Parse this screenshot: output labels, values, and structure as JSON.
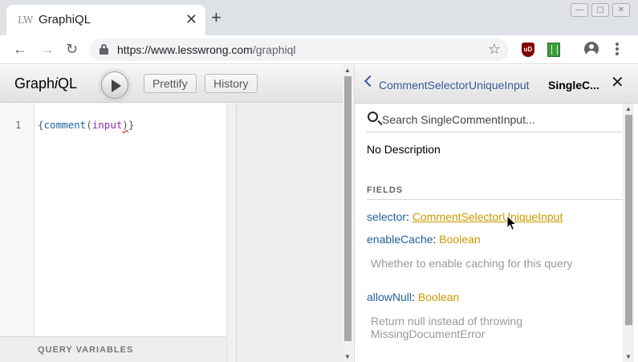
{
  "browser": {
    "tab_favicon": "LW",
    "tab_title": "GraphiQL",
    "tab_close": "✕",
    "new_tab": "+",
    "window_buttons": [
      "—",
      "▢",
      "✕"
    ],
    "back": "←",
    "forward": "→",
    "reload": "↻",
    "url_host": "https://www.lesswrong.com",
    "url_path": "/graphiql",
    "star": "☆",
    "ublock_label": "uD"
  },
  "graphiql": {
    "logo_prefix": "Graph",
    "logo_italic": "i",
    "logo_suffix": "QL",
    "prettify_label": "Prettify",
    "history_label": "History",
    "editor": {
      "line_number": "1",
      "code_open": "{",
      "code_fn": "comment",
      "code_paren_open": "(",
      "code_arg": "input",
      "code_paren_close": ")",
      "code_close": "}"
    },
    "query_variables_label": "QUERY VARIABLES"
  },
  "docs": {
    "back_label": "CommentSelectorUniqueInput",
    "title": "SingleC...",
    "close": "✕",
    "search_placeholder": "Search SingleCommentInput...",
    "description": "No Description",
    "fields_label": "FIELDS",
    "fields": [
      {
        "name": "selector",
        "type": "CommentSelectorUniqueInput",
        "description": ""
      },
      {
        "name": "enableCache",
        "type": "Boolean",
        "description": "Whether to enable caching for this query"
      },
      {
        "name": "allowNull",
        "type": "Boolean",
        "description": "Return null instead of throwing MissingDocumentError"
      }
    ]
  },
  "colors": {
    "field_name": "#1f61a0",
    "field_type": "#ca9800",
    "back_link": "#3b5998"
  }
}
